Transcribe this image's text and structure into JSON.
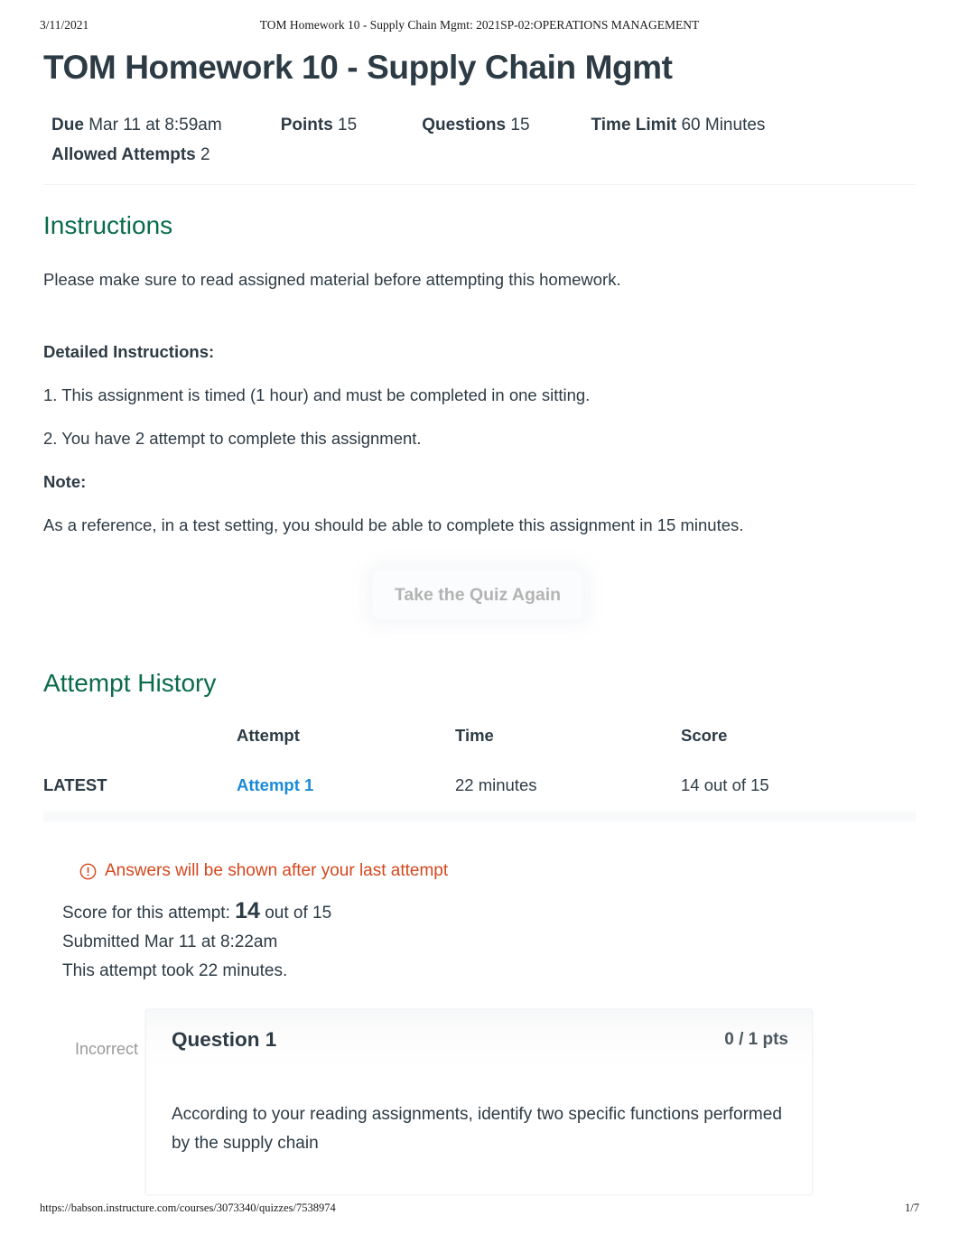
{
  "print_header": {
    "date": "3/11/2021",
    "title": "TOM Homework 10 - Supply Chain Mgmt: 2021SP-02:OPERATIONS MANAGEMENT"
  },
  "print_footer": {
    "url": "https://babson.instructure.com/courses/3073340/quizzes/7538974",
    "page": "1/7"
  },
  "quiz": {
    "title": "TOM Homework 10 - Supply Chain Mgmt",
    "meta": {
      "due_label": "Due",
      "due_value": "Mar 11 at 8:59am",
      "points_label": "Points",
      "points_value": "15",
      "questions_label": "Questions",
      "questions_value": "15",
      "time_limit_label": "Time Limit",
      "time_limit_value": "60 Minutes",
      "allowed_attempts_label": "Allowed Attempts",
      "allowed_attempts_value": "2"
    }
  },
  "instructions": {
    "heading": "Instructions",
    "intro": "Please make sure to read assigned material before attempting this homework.",
    "detailed_heading": "Detailed Instructions:",
    "item1": "1. This assignment is timed (1 hour) and must be completed in one sitting.",
    "item2": "2. You have 2 attempt to complete this assignment.",
    "note_heading": "Note:",
    "note_text": "As a reference, in a test setting, you should be able to complete this assignment in 15 minutes."
  },
  "retake": {
    "label": "Take the Quiz Again"
  },
  "attempt_history": {
    "heading": "Attempt History",
    "columns": {
      "flag": "",
      "attempt": "Attempt",
      "time": "Time",
      "score": "Score"
    },
    "rows": [
      {
        "flag": "LATEST",
        "attempt": "Attempt 1",
        "time": "22 minutes",
        "score": "14 out of 15"
      }
    ]
  },
  "warning": {
    "icon": "warning-circle-icon",
    "text": "Answers will be shown after your last attempt"
  },
  "attempt_summary": {
    "score_prefix": "Score for this attempt:",
    "score_value": "14",
    "score_suffix": "out of 15",
    "submitted": "Submitted Mar 11 at 8:22am",
    "duration": "This attempt took 22 minutes."
  },
  "question": {
    "status": "Incorrect",
    "title": "Question 1",
    "points": "0 / 1 pts",
    "text": "According to your reading assignments, identify two specific functions performed by the supply chain"
  },
  "colors": {
    "heading_green": "#0a6b4b",
    "link_blue": "#1a8ad8",
    "warning_orange": "#d4471e",
    "text": "#2d3b45",
    "muted": "#9a9a9a"
  }
}
